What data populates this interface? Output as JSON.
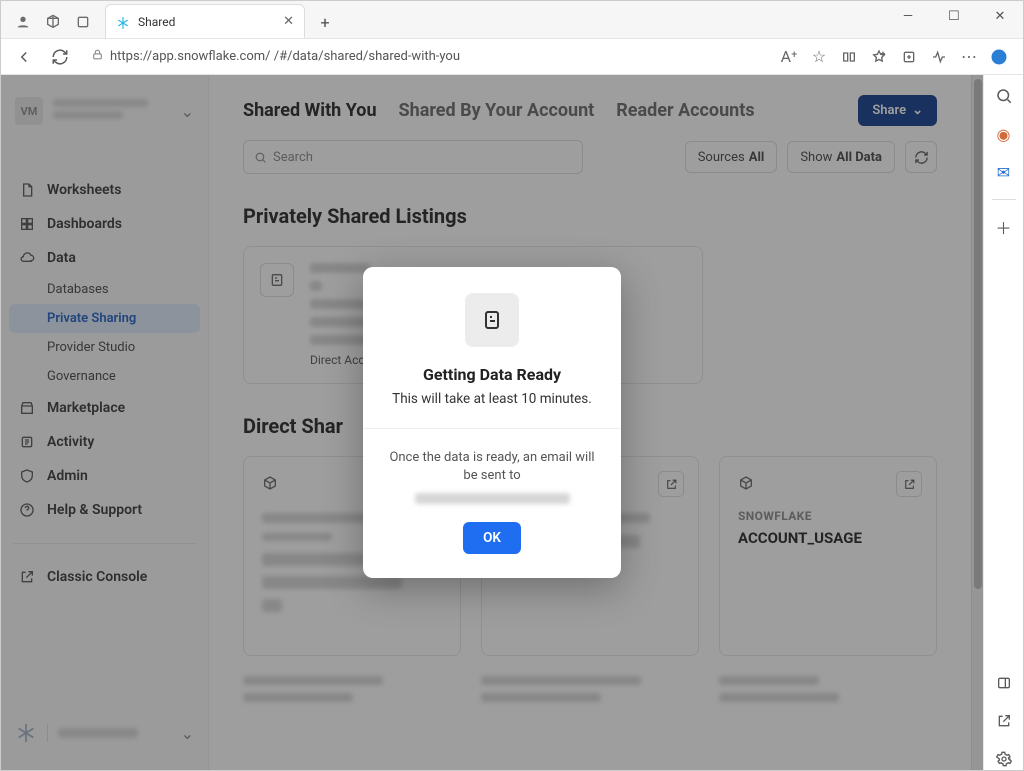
{
  "browser": {
    "tab_title": "Shared",
    "url": "https://app.snowflake.com/                    /#/data/shared/shared-with-you"
  },
  "sidebar": {
    "org_initials": "VM",
    "nav": {
      "worksheets": "Worksheets",
      "dashboards": "Dashboards",
      "data": "Data",
      "databases": "Databases",
      "private_sharing": "Private Sharing",
      "provider_studio": "Provider Studio",
      "governance": "Governance",
      "marketplace": "Marketplace",
      "activity": "Activity",
      "admin": "Admin",
      "help": "Help & Support",
      "classic_console": "Classic Console"
    }
  },
  "main": {
    "tabs": {
      "shared_with_you": "Shared With You",
      "shared_by_account": "Shared By Your Account",
      "reader_accounts": "Reader Accounts"
    },
    "share_button": "Share",
    "search_placeholder": "Search",
    "filter_sources_label": "Sources",
    "filter_sources_value": "All",
    "filter_show_label": "Show",
    "filter_show_value": "All Data",
    "section_privately_shared": "Privately Shared Listings",
    "listing_tag": "Direct Acc",
    "section_direct_shares": "Direct Shar",
    "cards": {
      "c3_provider": "SNOWFLAKE",
      "c3_name": "ACCOUNT_USAGE"
    }
  },
  "modal": {
    "title": "Getting Data Ready",
    "subtitle": "This will take at least 10 minutes.",
    "body": "Once the data is ready, an email will be sent to",
    "ok": "OK"
  }
}
